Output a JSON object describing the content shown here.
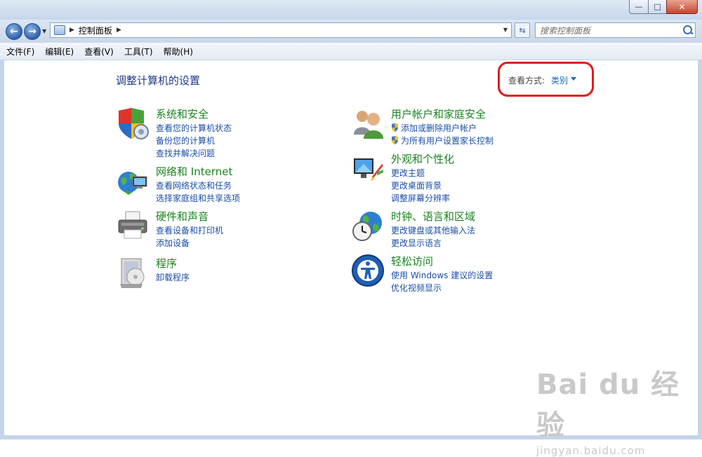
{
  "window": {
    "min_glyph": "—",
    "max_glyph": "□",
    "close_glyph": "✕"
  },
  "address": {
    "breadcrumb": "控制面板",
    "search_placeholder": "搜索控制面板"
  },
  "menu": [
    "文件(F)",
    "编辑(E)",
    "查看(V)",
    "工具(T)",
    "帮助(H)"
  ],
  "page": {
    "title": "调整计算机的设置",
    "view_by_label": "查看方式:",
    "view_by_value": "类别"
  },
  "categories": {
    "system": {
      "title": "系统和安全",
      "links": [
        "查看您的计算机状态",
        "备份您的计算机",
        "查找并解决问题"
      ]
    },
    "network": {
      "title": "网络和 Internet",
      "links": [
        "查看网络状态和任务",
        "选择家庭组和共享选项"
      ]
    },
    "hardware": {
      "title": "硬件和声音",
      "links": [
        "查看设备和打印机",
        "添加设备"
      ]
    },
    "programs": {
      "title": "程序",
      "links": [
        "卸载程序"
      ]
    },
    "users": {
      "title": "用户帐户和家庭安全",
      "links": [
        "添加或删除用户帐户",
        "为所有用户设置家长控制"
      ]
    },
    "appearance": {
      "title": "外观和个性化",
      "links": [
        "更改主题",
        "更改桌面背景",
        "调整屏幕分辨率"
      ]
    },
    "clock": {
      "title": "时钟、语言和区域",
      "links": [
        "更改键盘或其他输入法",
        "更改显示语言"
      ]
    },
    "ease": {
      "title": "轻松访问",
      "links": [
        "使用 Windows 建议的设置",
        "优化视频显示"
      ]
    }
  },
  "watermark": {
    "main": "Bai du 经验",
    "sub": "jingyan.baidu.com"
  },
  "colors": {
    "category_title": "#19841e",
    "link": "#1a4ea8",
    "highlight": "#e21b1b"
  }
}
